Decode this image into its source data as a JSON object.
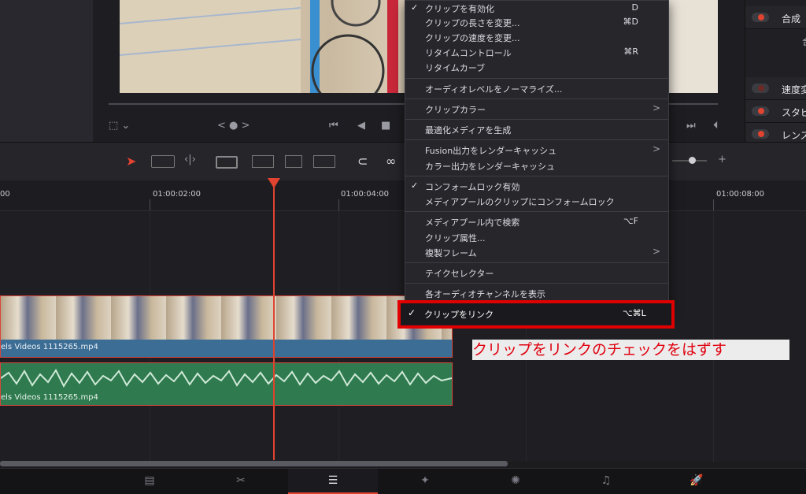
{
  "viewer": {
    "nav_glyph": "< ● >",
    "transport": {
      "first": "⏮",
      "back": "◀",
      "stop": "■",
      "next": "▶",
      "last": "⏭"
    }
  },
  "inspector": {
    "items": [
      {
        "label": "合成",
        "sub": "合"
      },
      {
        "label": "速度変"
      },
      {
        "label": "スタビ"
      },
      {
        "label": "レンズ"
      }
    ]
  },
  "ruler": {
    "timecodes": [
      "00",
      "01:00:02:00",
      "01:00:04:00",
      "01:00:08:00"
    ]
  },
  "clips": {
    "video_name": "els Videos 1115265.mp4",
    "audio_name": "els Videos 1115265.mp4"
  },
  "context_menu": {
    "items": [
      {
        "label": "クリップを有効化",
        "shortcut": "D",
        "checked": true
      },
      {
        "label": "クリップの長さを変更...",
        "shortcut": "⌘D"
      },
      {
        "label": "クリップの速度を変更...",
        "shortcut": ""
      },
      {
        "label": "リタイムコントロール",
        "shortcut": "⌘R"
      },
      {
        "label": "リタイムカーブ",
        "shortcut": ""
      },
      {
        "label": "オーディオレベルをノーマライズ...",
        "shortcut": ""
      },
      {
        "label": "クリップカラー",
        "shortcut": "",
        "submenu": true
      },
      {
        "label": "最適化メディアを生成",
        "shortcut": ""
      },
      {
        "label": "Fusion出力をレンダーキャッシュ",
        "shortcut": "",
        "submenu": true
      },
      {
        "label": "カラー出力をレンダーキャッシュ",
        "shortcut": ""
      },
      {
        "label": "コンフォームロック有効",
        "shortcut": "",
        "checked": true
      },
      {
        "label": "メディアプールのクリップにコンフォームロック",
        "shortcut": ""
      },
      {
        "label": "メディアプール内で検索",
        "shortcut": "⌥F"
      },
      {
        "label": "クリップ属性...",
        "shortcut": ""
      },
      {
        "label": "複製フレーム",
        "shortcut": "",
        "submenu": true
      },
      {
        "label": "テイクセレクター",
        "shortcut": ""
      },
      {
        "label": "各オーディオチャンネルを表示",
        "shortcut": ""
      }
    ],
    "highlighted": {
      "label": "クリップをリンク",
      "shortcut": "⌥⌘L",
      "checked": true
    },
    "check_glyph": "✓",
    "arrow_glyph": ">"
  },
  "annotation": {
    "text": "クリップをリンクのチェックをはずす"
  },
  "page_tabs": [
    {
      "name": "media",
      "glyph": "▤"
    },
    {
      "name": "cut",
      "glyph": "✂"
    },
    {
      "name": "edit",
      "glyph": "☰",
      "active": true
    },
    {
      "name": "fusion",
      "glyph": "✦"
    },
    {
      "name": "color",
      "glyph": "✺"
    },
    {
      "name": "fairlight",
      "glyph": "♫"
    },
    {
      "name": "deliver",
      "glyph": "🚀"
    }
  ],
  "colors": {
    "accent": "#e0432f",
    "highlight_box": "#e00000",
    "annotation_text": "#e0000e"
  }
}
